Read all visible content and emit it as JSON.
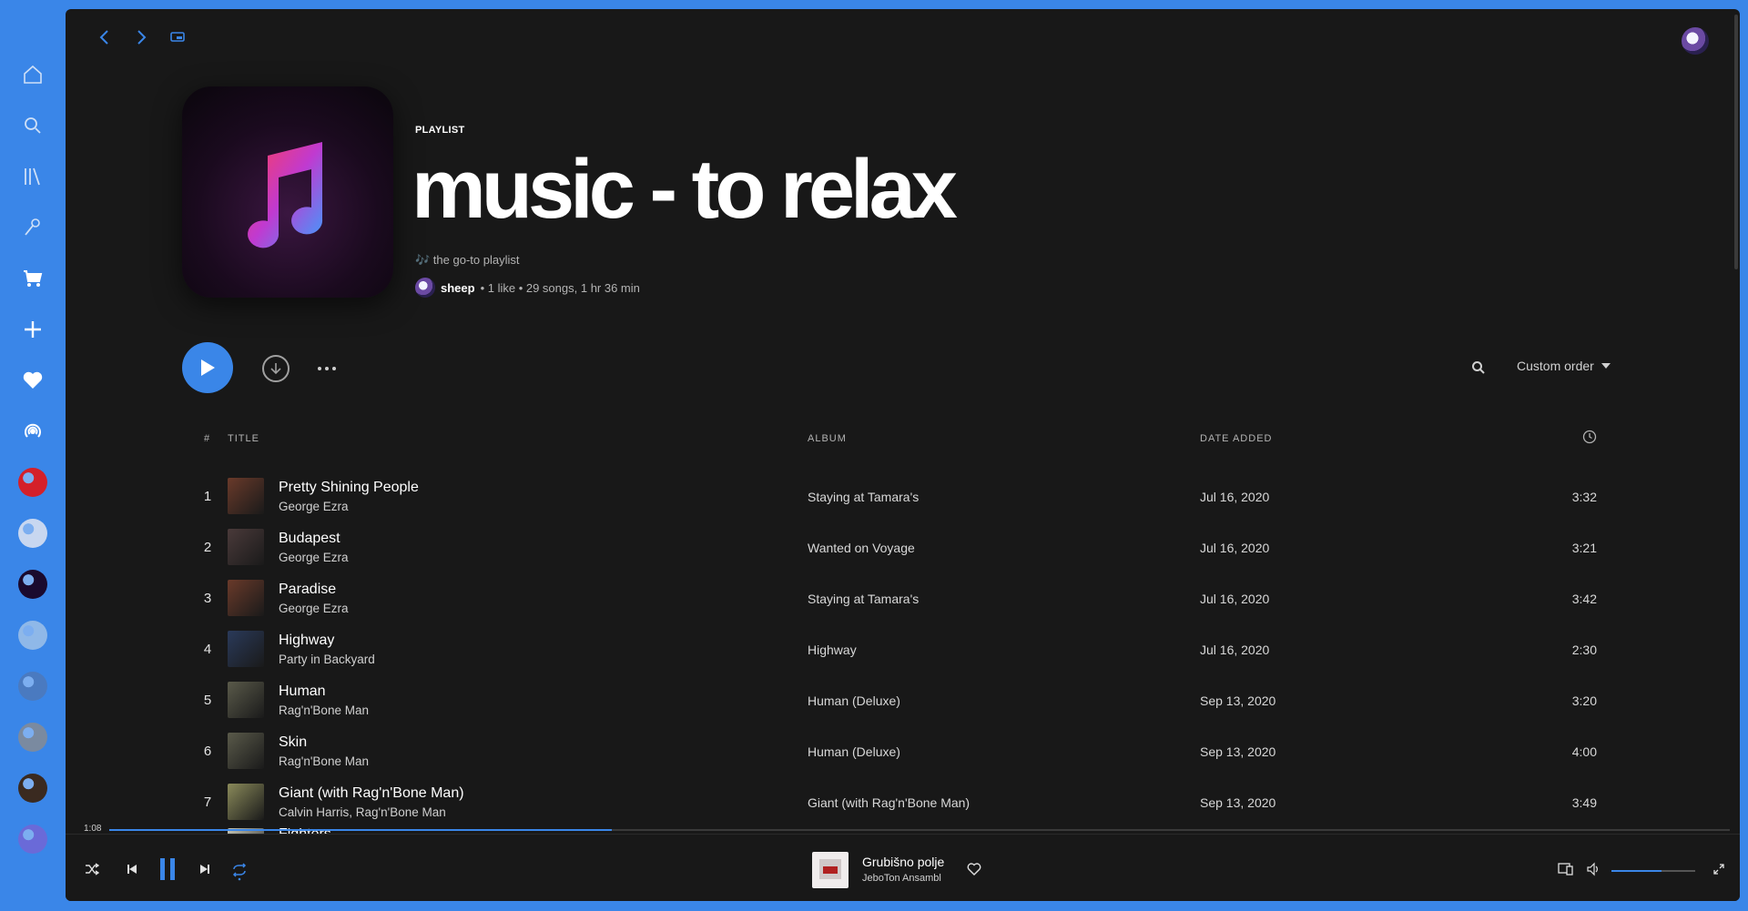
{
  "colors": {
    "accent": "#3a86e8",
    "background": "#181818",
    "desktop": "#3a86e8"
  },
  "dock": {
    "items": [
      {
        "icon": "home-icon"
      },
      {
        "icon": "search-icon"
      },
      {
        "icon": "library-icon"
      },
      {
        "icon": "microphone-icon"
      },
      {
        "icon": "cart-icon"
      },
      {
        "icon": "plus-icon"
      },
      {
        "icon": "heart-icon"
      },
      {
        "icon": "podcast-icon"
      }
    ],
    "playlists": [
      {
        "color": "#d4202a"
      },
      {
        "color": "#c8d7f0"
      },
      {
        "color": "#1a0a2e"
      },
      {
        "color": "#8fb8e8"
      },
      {
        "color": "#4a7ac0"
      },
      {
        "color": "#7a8aa0"
      },
      {
        "color": "#3a2a20"
      },
      {
        "color": "#6a6ad8"
      }
    ]
  },
  "header": {
    "type": "PLAYLIST",
    "title": "music - to relax",
    "description": "🎶 the go-to playlist",
    "owner": "sheep",
    "stats": "• 1 like • 29 songs, 1 hr 36 min"
  },
  "actions": {
    "sort": "Custom order"
  },
  "table": {
    "headers": {
      "num": "#",
      "title": "TITLE",
      "album": "ALBUM",
      "date": "DATE ADDED"
    },
    "rows": [
      {
        "num": "1",
        "title": "Pretty Shining People",
        "artist": "George Ezra",
        "album": "Staying at Tamara's",
        "date": "Jul 16, 2020",
        "duration": "3:32",
        "thumb": "#6a3a2a"
      },
      {
        "num": "2",
        "title": "Budapest",
        "artist": "George Ezra",
        "album": "Wanted on Voyage",
        "date": "Jul 16, 2020",
        "duration": "3:21",
        "thumb": "#4a3a3a"
      },
      {
        "num": "3",
        "title": "Paradise",
        "artist": "George Ezra",
        "album": "Staying at Tamara's",
        "date": "Jul 16, 2020",
        "duration": "3:42",
        "thumb": "#6a3a2a"
      },
      {
        "num": "4",
        "title": "Highway",
        "artist": "Party in Backyard",
        "album": "Highway",
        "date": "Jul 16, 2020",
        "duration": "2:30",
        "thumb": "#2a3a5a"
      },
      {
        "num": "5",
        "title": "Human",
        "artist": "Rag'n'Bone Man",
        "album": "Human (Deluxe)",
        "date": "Sep 13, 2020",
        "duration": "3:20",
        "thumb": "#5a5a4a"
      },
      {
        "num": "6",
        "title": "Skin",
        "artist": "Rag'n'Bone Man",
        "album": "Human (Deluxe)",
        "date": "Sep 13, 2020",
        "duration": "4:00",
        "thumb": "#5a5a4a"
      },
      {
        "num": "7",
        "title": "Giant (with Rag'n'Bone Man)",
        "artist": "Calvin Harris, Rag'n'Bone Man",
        "album": "Giant (with Rag'n'Bone Man)",
        "date": "Sep 13, 2020",
        "duration": "3:49",
        "thumb": "#8a8a5a"
      },
      {
        "num": "8",
        "title": "Fighters",
        "artist": "",
        "album": "",
        "date": "",
        "duration": "",
        "thumb": "#c8c8b8"
      }
    ]
  },
  "player": {
    "elapsed": "1:08",
    "progress_fraction": 0.31,
    "track_title": "Grubišno polje",
    "track_artist": "JeboTon Ansambl",
    "volume_fraction": 0.6
  }
}
